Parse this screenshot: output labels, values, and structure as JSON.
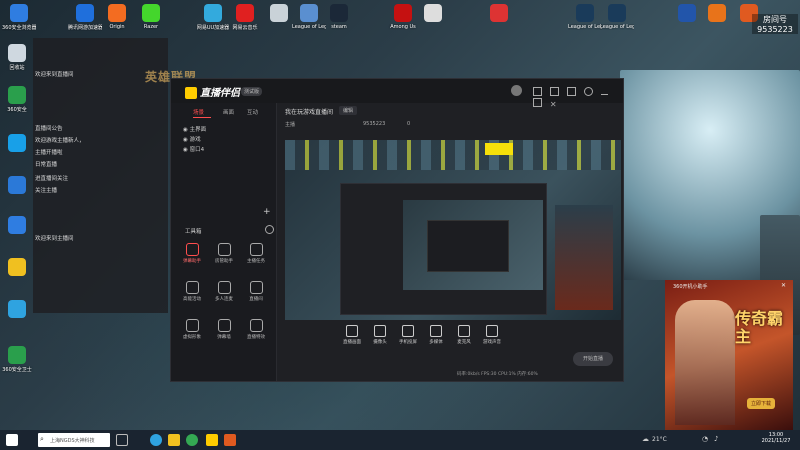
{
  "desktop": {
    "icons": [
      {
        "label": "360安全浏览器",
        "color": "#2f7de1"
      },
      {
        "label": "腾讯网游加速器",
        "color": "#1f6fdc"
      },
      {
        "label": "Origin",
        "color": "#f36c21"
      },
      {
        "label": "Razer",
        "color": "#44d62c"
      },
      {
        "label": "网易UU加速器",
        "color": "#33aadd"
      },
      {
        "label": "网易云音乐",
        "color": "#e02020"
      },
      {
        "label": "",
        "color": "#c9d2d8"
      },
      {
        "label": "League of Legends",
        "color": "#5a8fd0"
      },
      {
        "label": "steam",
        "color": "#1b2838"
      },
      {
        "label": "Among Us",
        "color": "#c51111"
      },
      {
        "label": "",
        "color": "#ddd"
      },
      {
        "label": "",
        "color": "#d33"
      },
      {
        "label": "League of Legends",
        "color": "#1a3b5a"
      },
      {
        "label": "League of Legends",
        "color": "#1a3b5a"
      },
      {
        "label": "",
        "color": "#2255aa"
      },
      {
        "label": "",
        "color": "#e8731a"
      },
      {
        "label": "",
        "color": "#e05a20"
      }
    ],
    "left_icons": [
      {
        "label": "回收站",
        "color": "#cfd8e0"
      },
      {
        "label": "360安全",
        "color": "#2a9f4c"
      },
      {
        "label": "",
        "color": "#18a0e8"
      },
      {
        "label": "",
        "color": "#2b79d8"
      },
      {
        "label": "",
        "color": "#2f7de1"
      },
      {
        "label": "",
        "color": "#f0c020"
      },
      {
        "label": "",
        "color": "#2fa3e0"
      },
      {
        "label": "360安全卫士",
        "color": "#2a9f4c"
      }
    ]
  },
  "room_overlay": {
    "line1": "房间号",
    "room_id": "9535223"
  },
  "left_panel": {
    "lines": [
      "欢迎来到直播间",
      "直播间公告",
      "欢迎游戏主播新人，",
      "主播开播啦",
      "日常直播",
      "进直播间关注",
      "关注主播",
      "欢迎来到主播间"
    ]
  },
  "main_window": {
    "app_name": "直播伴侣",
    "badge": "测试版",
    "side_tabs": [
      "场景",
      "画面",
      "互动"
    ],
    "scenes": [
      "主界面",
      "游戏",
      "窗口4"
    ],
    "tools_title": "工具箱",
    "tools": [
      {
        "label": "弹幕助手"
      },
      {
        "label": "房管助手"
      },
      {
        "label": "主播任务"
      },
      {
        "label": "高能活动"
      },
      {
        "label": "多人连麦"
      },
      {
        "label": "直播间"
      },
      {
        "label": "虚拟形象"
      },
      {
        "label": "弹幕墙"
      },
      {
        "label": "直播特效"
      }
    ],
    "room_title": "我在玩游戏直播间",
    "edit_label": "编辑",
    "room_meta": [
      "主播",
      "9535223",
      "0"
    ],
    "bottom_tools": [
      {
        "label": "直播画面"
      },
      {
        "label": "摄像头"
      },
      {
        "label": "手机投屏"
      },
      {
        "label": "多媒体"
      },
      {
        "label": "麦克风"
      },
      {
        "label": "游戏声音"
      }
    ],
    "start_label": "开始直播",
    "status": "码率:0kb/s  FPS:30  CPU:1%  内存:60%"
  },
  "ad": {
    "title": "传奇霸主",
    "subtitle": "立即下载",
    "top_label": "360开机小助手"
  },
  "taskbar": {
    "search_placeholder": "上海NGDS大神科技",
    "temperature": "21°C",
    "time": "13:00",
    "date": "2021/11/27"
  }
}
